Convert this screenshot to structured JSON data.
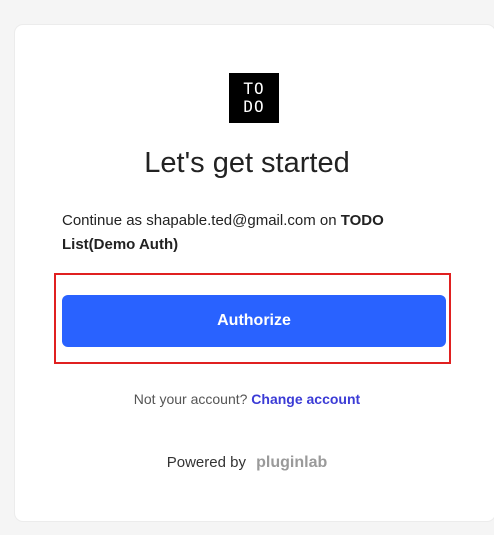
{
  "logo": {
    "line1": "TO",
    "line2": "DO"
  },
  "title": "Let's get started",
  "consent": {
    "prefix": "Continue as",
    "email": "shapable.ted@gmail.com",
    "on": "on",
    "app_name": "TODO List(Demo Auth)"
  },
  "authorize_label": "Authorize",
  "account": {
    "prompt": "Not your account?",
    "change_label": "Change account"
  },
  "footer": {
    "powered_by": "Powered by",
    "brand": "pluginlab"
  },
  "colors": {
    "primary": "#2962ff",
    "link": "#3b3bd6",
    "highlight": "#e02020"
  }
}
